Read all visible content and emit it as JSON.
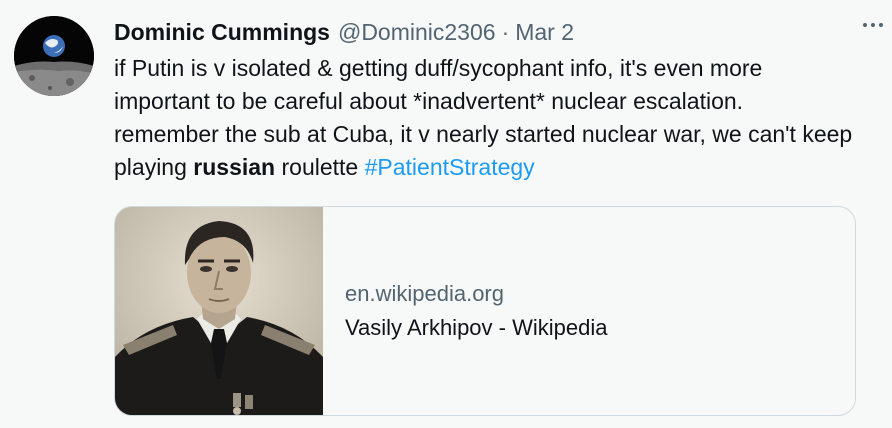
{
  "author": {
    "name": "Dominic Cummings",
    "handle": "@Dominic2306",
    "separator": "·",
    "time": "Mar 2"
  },
  "tweet": {
    "text_parts": [
      "if Putin is v isolated & getting duff/sycophant info, it's even more important to be careful about *inadvertent* nuclear escalation. remember the sub at Cuba, it v nearly started nuclear war, we can't keep playing ",
      "russian",
      " roulette ",
      "#PatientStrategy"
    ]
  },
  "card": {
    "domain": "en.wikipedia.org",
    "title": "Vasily Arkhipov - Wikipedia"
  },
  "icons": {
    "more": "more-options-icon"
  },
  "colors": {
    "background": "#f7f9f9",
    "text": "#0f1419",
    "secondary": "#536471",
    "link": "#1d9bf0",
    "border": "#cfd9de"
  }
}
